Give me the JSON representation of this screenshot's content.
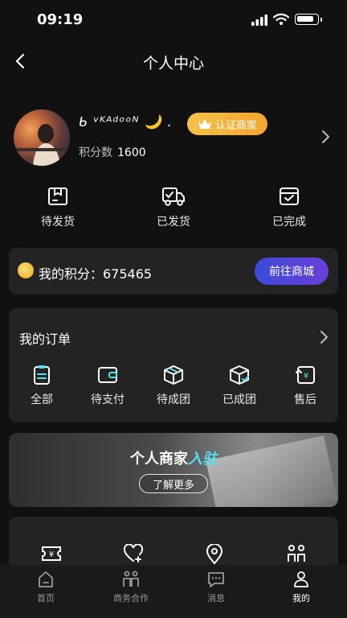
{
  "status_bar": {
    "time": "09:19"
  },
  "header": {
    "title": "个人中心"
  },
  "profile": {
    "username": "ᑲ ᵛᴷᴬᵈᵒᵒᴺ 🌙 .",
    "badge_label": "认证商家",
    "points_label": "积分数",
    "points_value": "1600"
  },
  "shipping": [
    {
      "label": "待发货",
      "icon": "box-icon"
    },
    {
      "label": "已发货",
      "icon": "truck-icon"
    },
    {
      "label": "已完成",
      "icon": "check-box-icon"
    }
  ],
  "points_card": {
    "label": "我的积分：675465",
    "button": "前往商城"
  },
  "orders": {
    "title": "我的订单",
    "items": [
      {
        "label": "全部",
        "icon": "clipboard-icon"
      },
      {
        "label": "待支付",
        "icon": "wallet-icon"
      },
      {
        "label": "待成团",
        "icon": "cube-icon"
      },
      {
        "label": "已成团",
        "icon": "cube-done-icon"
      },
      {
        "label": "售后",
        "icon": "refund-icon"
      }
    ]
  },
  "banner": {
    "title_main": "个人商家",
    "title_accent": "入驻",
    "button": "了解更多"
  },
  "services": [
    {
      "icon": "coupon-icon"
    },
    {
      "icon": "heart-add-icon"
    },
    {
      "icon": "location-icon"
    },
    {
      "icon": "people-icon"
    }
  ],
  "tabbar": [
    {
      "label": "首页",
      "icon": "home-icon"
    },
    {
      "label": "商务合作",
      "icon": "cooperation-icon"
    },
    {
      "label": "消息",
      "icon": "message-icon"
    },
    {
      "label": "我的",
      "icon": "user-icon",
      "active": true
    }
  ],
  "colors": {
    "accent_cyan": "#56e0f0",
    "badge_gold": "#f3a630",
    "button_purple": "#5a44d8"
  }
}
